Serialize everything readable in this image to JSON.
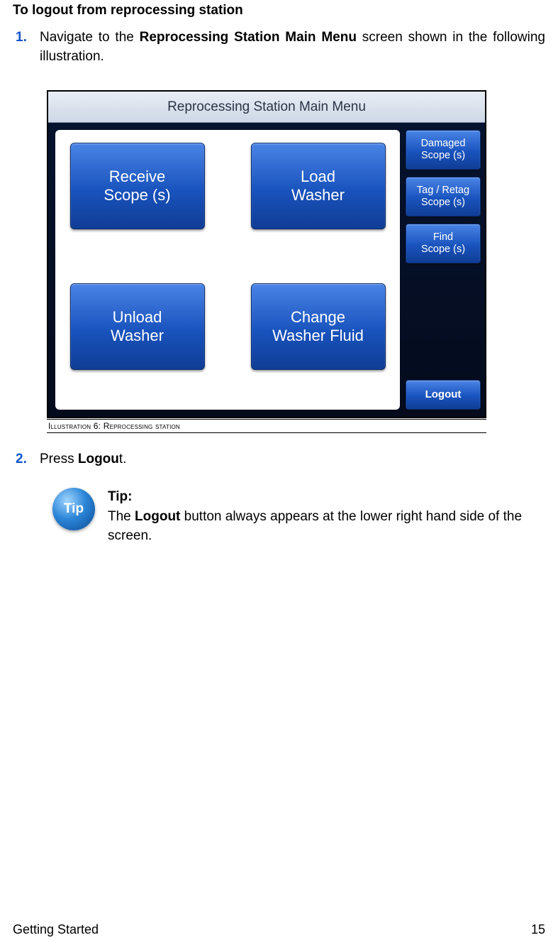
{
  "section_title": "To logout from reprocessing station",
  "steps": [
    {
      "num": "1.",
      "pre": "Navigate to the ",
      "bold": "Reprocessing Station Main Menu",
      "post": " screen shown in the following illustration."
    },
    {
      "num": "2.",
      "pre": "Press ",
      "bold": "Logou",
      "post": "t."
    }
  ],
  "illustration": {
    "titlebar": "Reprocessing Station Main Menu",
    "main_buttons": [
      "Receive\nScope (s)",
      "Load\nWasher",
      "Unload\nWasher",
      "Change\nWasher Fluid"
    ],
    "side_buttons": [
      "Damaged\nScope (s)",
      "Tag / Retag\nScope (s)",
      "Find\nScope (s)"
    ],
    "logout_label": "Logout",
    "caption": "Illustration 6: Reprocessing station"
  },
  "tip": {
    "icon_label": "Tip",
    "title": "Tip:",
    "body_pre": "The ",
    "body_bold": "Logout",
    "body_post": " button always appears at the lower right hand side of the screen."
  },
  "footer": {
    "left": "Getting Started",
    "right": "15"
  }
}
